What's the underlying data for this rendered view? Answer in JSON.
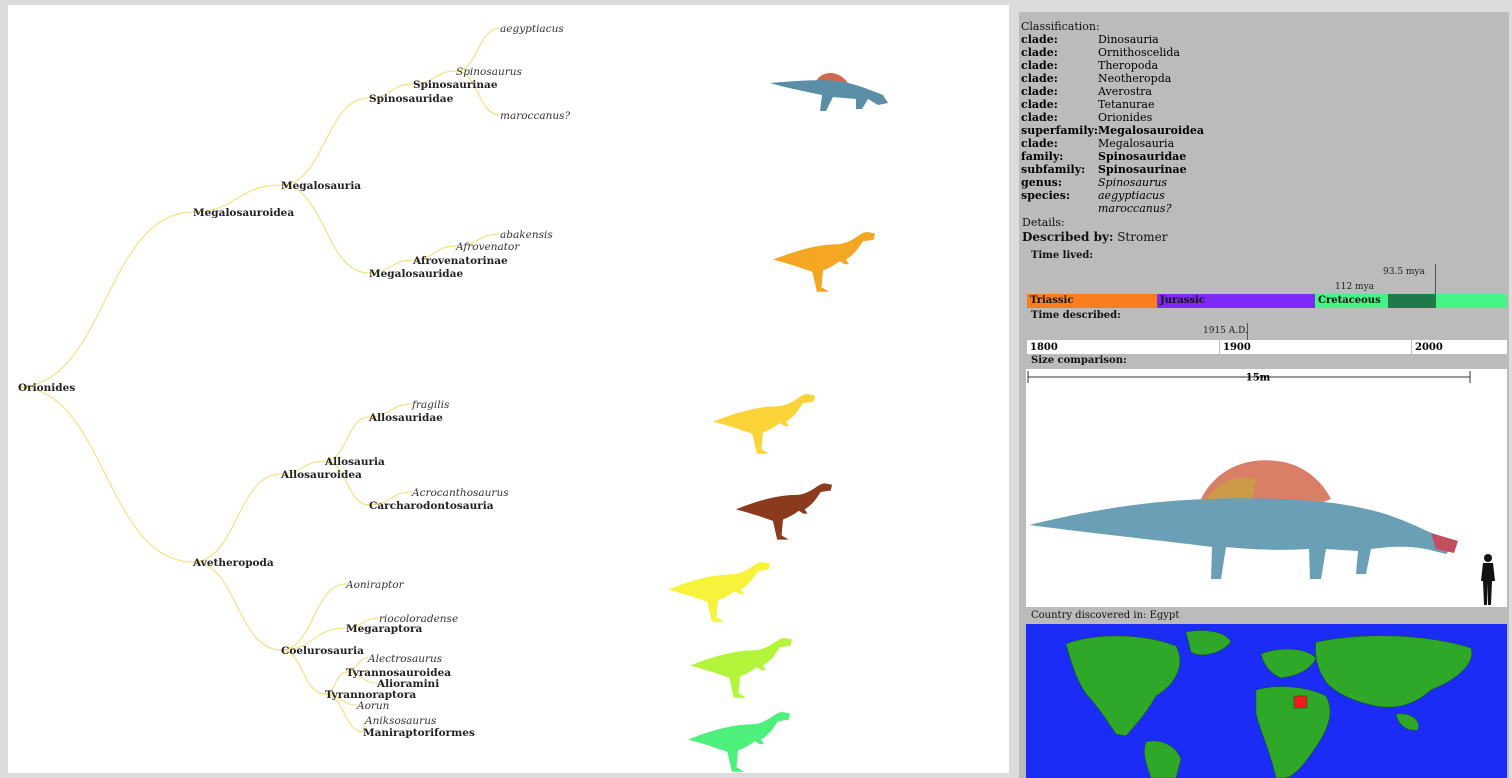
{
  "tree": {
    "root": "Orionides",
    "nodes": {
      "megalosauroidea": "Megalosauroidea",
      "megalosauria": "Megalosauria",
      "spinosauridae": "Spinosauridae",
      "spinosaurinae": "Spinosaurinae",
      "spinosaurus": "Spinosaurus",
      "aegyptiacus": "aegyptiacus",
      "maroccanus": "maroccanus?",
      "megalosauridae": "Megalosauridae",
      "afrovenatorinae": "Afrovenatorinae",
      "afrovenator": "Afrovenator",
      "abakensis": "abakensis",
      "avetheropoda": "Avetheropoda",
      "allosauria": "Allosauria",
      "allosauroidea": "Allosauroidea",
      "allosauridae": "Allosauridae",
      "fragilis": "fragilis",
      "carcharodontosauria": "Carcharodontosauria",
      "acrocanthosaurus": "Acrocanthosaurus",
      "coelurosauria": "Coelurosauria",
      "aoniraptor": "Aoniraptor",
      "megaraptora": "Megaraptora",
      "riocoloradense": "riocoloradense",
      "tyrannoraptora": "Tyrannoraptora",
      "tyrannosauroidea": "Tyrannosauroidea",
      "alectrosaurus": "Alectrosaurus",
      "alioramini": "Alioramini",
      "aorun": "Aorun",
      "maniraptoriformes": "Maniraptoriformes",
      "aniksosaurus": "Aniksosaurus"
    },
    "link_color": "#f5dc6e",
    "silhouettes": [
      {
        "name": "spinosaurus",
        "color": "#5b8fa8"
      },
      {
        "name": "afrovenator",
        "color": "#f5a623"
      },
      {
        "name": "allosaurus",
        "color": "#fcd43a"
      },
      {
        "name": "acrocanthosaurus",
        "color": "#8b3a1e"
      },
      {
        "name": "aoniraptor",
        "color": "#f7f23a"
      },
      {
        "name": "tyrannosauroid",
        "color": "#b3f53a"
      },
      {
        "name": "maniraptoriform",
        "color": "#4cf07a"
      }
    ]
  },
  "info": {
    "classification_label": "Classification:",
    "classification": [
      {
        "rank": "clade:",
        "value": "Dinosauria",
        "rank_bold": true,
        "value_style": "normal"
      },
      {
        "rank": "clade:",
        "value": "Ornithoscelida",
        "rank_bold": true,
        "value_style": "normal"
      },
      {
        "rank": "clade:",
        "value": "Theropoda",
        "rank_bold": true,
        "value_style": "normal"
      },
      {
        "rank": "clade:",
        "value": "Neotheropda",
        "rank_bold": true,
        "value_style": "normal"
      },
      {
        "rank": "clade:",
        "value": "Averostra",
        "rank_bold": true,
        "value_style": "normal"
      },
      {
        "rank": "clade:",
        "value": "Tetanurae",
        "rank_bold": true,
        "value_style": "normal"
      },
      {
        "rank": "clade:",
        "value": "Orionides",
        "rank_bold": true,
        "value_style": "normal"
      },
      {
        "rank": "superfamily:",
        "value": "Megalosauroidea",
        "rank_bold": true,
        "value_style": "bold"
      },
      {
        "rank": "clade:",
        "value": "Megalosauria",
        "rank_bold": true,
        "value_style": "normal"
      },
      {
        "rank": "family:",
        "value": "Spinosauridae",
        "rank_bold": true,
        "value_style": "bold"
      },
      {
        "rank": "subfamily:",
        "value": "Spinosaurinae",
        "rank_bold": true,
        "value_style": "bold"
      },
      {
        "rank": "genus:",
        "value": "Spinosaurus",
        "rank_bold": true,
        "value_style": "italic"
      },
      {
        "rank": "species:",
        "value": "aegyptiacus",
        "rank_bold": true,
        "value_style": "italic"
      },
      {
        "rank": "",
        "value": "maroccanus?",
        "rank_bold": false,
        "value_style": "italic"
      }
    ],
    "details_label": "Details:",
    "described_by_label": "Described by:",
    "described_by": "Stromer",
    "time_lived_label": "Time lived:",
    "periods": [
      {
        "name": "Triassic",
        "color": "#fa7e1e"
      },
      {
        "name": "Jurassic",
        "color": "#7e29f5"
      },
      {
        "name": "Cretaceous",
        "color": "#44f585"
      }
    ],
    "lived_range_color": "#1f7a47",
    "lived_start_label": "112 mya",
    "lived_end_label": "93.5 mya",
    "time_described_label": "Time described:",
    "years": [
      "1800",
      "1900",
      "2000"
    ],
    "described_year_label": "1915 A.D.",
    "size_label": "Size comparison:",
    "size_scale": "15m",
    "country_label": "Country discovered in: Egypt",
    "map_land_color": "#2fa82a",
    "map_highlight_color": "#ee1d1d"
  }
}
